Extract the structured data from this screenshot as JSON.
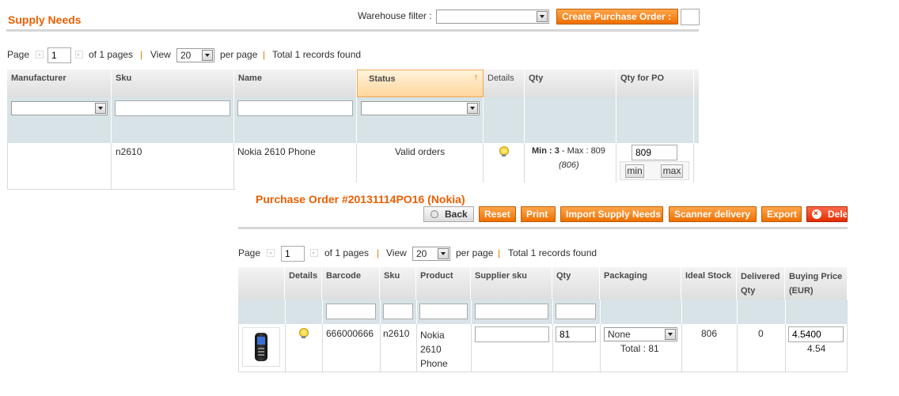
{
  "supply": {
    "title": "Supply Needs",
    "warehouse_label": "Warehouse filter :",
    "warehouse_value": "",
    "create_po": "Create Purchase Order :",
    "pager": {
      "page_label": "Page",
      "page": "1",
      "of_pages": "of 1 pages",
      "view_label": "View",
      "view": "20",
      "per_page": "per page",
      "total": "Total 1 records found"
    },
    "columns": [
      "Manufacturer",
      "Sku",
      "Name",
      "Status",
      "Details",
      "Qty",
      "Qty for PO"
    ],
    "row": {
      "manufacturer": "",
      "sku": "n2610",
      "name": "Nokia 2610 Phone",
      "status": "Valid orders",
      "qty_min": "Min : 3",
      "qty_max": " - Max : 809",
      "qty_paren": "(806)",
      "qty_po": "809",
      "min_btn": "min",
      "max_btn": "max"
    }
  },
  "po": {
    "title": "Purchase Order #20131114PO16 (Nokia)",
    "buttons": {
      "back": "Back",
      "reset": "Reset",
      "print": "Print",
      "import": "Import Supply Needs",
      "scanner": "Scanner delivery",
      "export": "Export",
      "delete": "Delete"
    },
    "pager": {
      "page_label": "Page",
      "page": "1",
      "of_pages": "of 1 pages",
      "view_label": "View",
      "view": "20",
      "per_page": "per page",
      "total": "Total 1 records found"
    },
    "columns": {
      "details": "Details",
      "barcode": "Barcode",
      "sku": "Sku",
      "product": "Product",
      "supplier_sku": "Supplier sku",
      "qty": "Qty",
      "packaging": "Packaging",
      "ideal_stock": "Ideal Stock",
      "delivered": "Delivered Qty",
      "buying": "Buying Price (EUR)"
    },
    "row": {
      "barcode": "666000666",
      "sku": "n2610",
      "product_l1": "Nokia",
      "product_l2": "2610",
      "product_l3": "Phone",
      "supplier_sku": "",
      "qty": "81",
      "packaging": "None",
      "packaging_total": "Total : 81",
      "ideal_stock": "806",
      "delivered": "0",
      "price_input": "4.5400",
      "price": "4.54"
    }
  },
  "colors": {
    "accent": "#eb5e00",
    "button": "#f27800",
    "filter_row": "#d7e3e7"
  }
}
